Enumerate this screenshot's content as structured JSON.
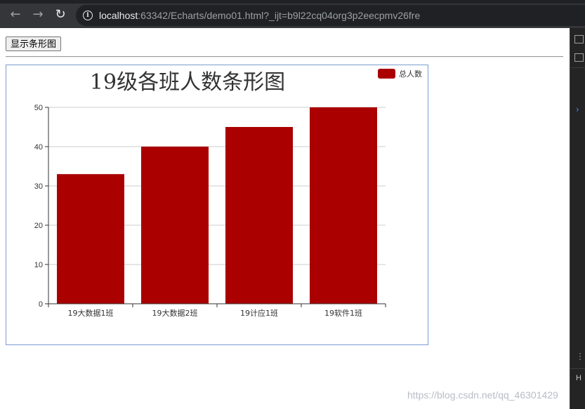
{
  "browser": {
    "url_host": "localhost",
    "url_rest": ":63342/Echarts/demo01.html?_ijt=b9l22cq04org3p2eecpmv26fre"
  },
  "page": {
    "button_label": "显示条形图"
  },
  "watermark": "https://blog.csdn.net/qq_46301429",
  "colors": {
    "bar": "#aa0000",
    "chrome_bar": "#35363a",
    "url_field": "#202124"
  },
  "chart_data": {
    "type": "bar",
    "title": "19级各班人数条形图",
    "categories": [
      "19大数据1班",
      "19大数据2班",
      "19计应1班",
      "19软件1班"
    ],
    "series": [
      {
        "name": "总人数",
        "values": [
          33,
          40,
          45,
          50
        ]
      }
    ],
    "ylim": [
      0,
      50
    ],
    "yticks": [
      0,
      10,
      20,
      30,
      40,
      50
    ],
    "grid": true,
    "legend": "top-right"
  }
}
